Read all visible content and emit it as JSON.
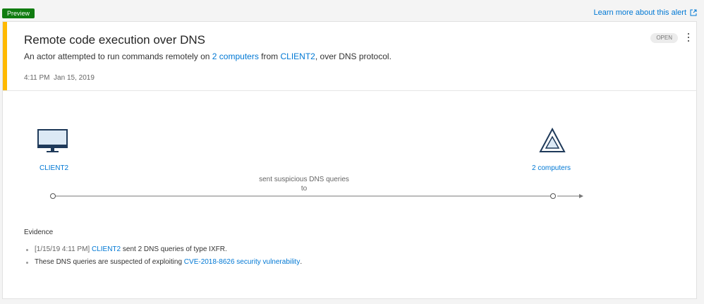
{
  "badge": {
    "preview": "Preview"
  },
  "header": {
    "learn_more": "Learn more about this alert",
    "external_icon": "external-link-icon"
  },
  "alert": {
    "title": "Remote code execution over DNS",
    "status": "OPEN",
    "desc": {
      "prefix": "An actor attempted to run commands remotely on ",
      "target_link": "2 computers",
      "mid": " from ",
      "source_link": "CLIENT2",
      "suffix": ", over DNS protocol."
    },
    "time": "4:11 PM  Jan 15, 2019",
    "accent_color": "#ffb900"
  },
  "graph": {
    "source": {
      "label": "CLIENT2",
      "icon": "monitor-icon"
    },
    "target": {
      "label": "2 computers",
      "icon": "triangle-group-icon"
    },
    "edge_label_line1": "sent suspicious DNS queries",
    "edge_label_line2": "to"
  },
  "evidence": {
    "title": "Evidence",
    "items": [
      {
        "prefix": "[1/15/19 4:11 PM] ",
        "link": "CLIENT2",
        "suffix": " sent 2 DNS queries of type IXFR."
      },
      {
        "prefix": "These DNS queries are suspected of exploiting ",
        "link": "CVE-2018-8626 security vulnerability",
        "suffix": "."
      }
    ]
  }
}
